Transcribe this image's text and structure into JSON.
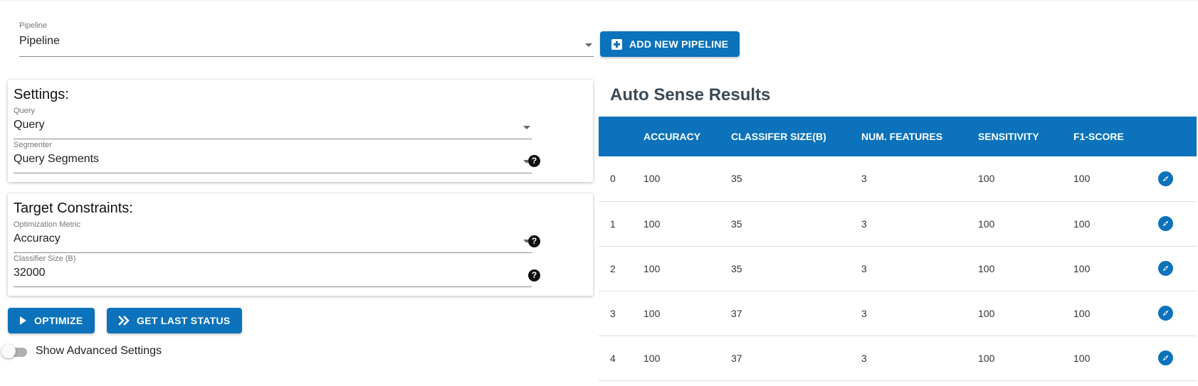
{
  "pipeline": {
    "label": "Pipeline",
    "value": "Pipeline"
  },
  "add_pipeline_button": "ADD NEW PIPELINE",
  "settings": {
    "title": "Settings:",
    "query": {
      "label": "Query",
      "value": "Query"
    },
    "segmenter": {
      "label": "Segmenter",
      "value": "Query Segments"
    }
  },
  "target": {
    "title": "Target Constraints:",
    "metric": {
      "label": "Optimization Metric",
      "value": "Accuracy"
    },
    "classifier_size": {
      "label": "Classifier Size (B)",
      "value": "32000"
    }
  },
  "buttons": {
    "optimize": "OPTIMIZE",
    "last_status": "GET LAST STATUS"
  },
  "advanced_toggle": {
    "label": "Show Advanced Settings",
    "on": false
  },
  "results": {
    "title": "Auto Sense Results",
    "columns": [
      "",
      "ACCURACY",
      "CLASSIFER SIZE(B)",
      "NUM. FEATURES",
      "SENSITIVITY",
      "F1-SCORE"
    ],
    "rows": [
      [
        "0",
        "100",
        "35",
        "3",
        "100",
        "100"
      ],
      [
        "1",
        "100",
        "35",
        "3",
        "100",
        "100"
      ],
      [
        "2",
        "100",
        "35",
        "3",
        "100",
        "100"
      ],
      [
        "3",
        "100",
        "37",
        "3",
        "100",
        "100"
      ],
      [
        "4",
        "100",
        "37",
        "3",
        "100",
        "100"
      ]
    ],
    "row_action_icon": "compass-icon"
  },
  "colors": {
    "primary": "#0b72bb",
    "title": "#3b4a55"
  }
}
